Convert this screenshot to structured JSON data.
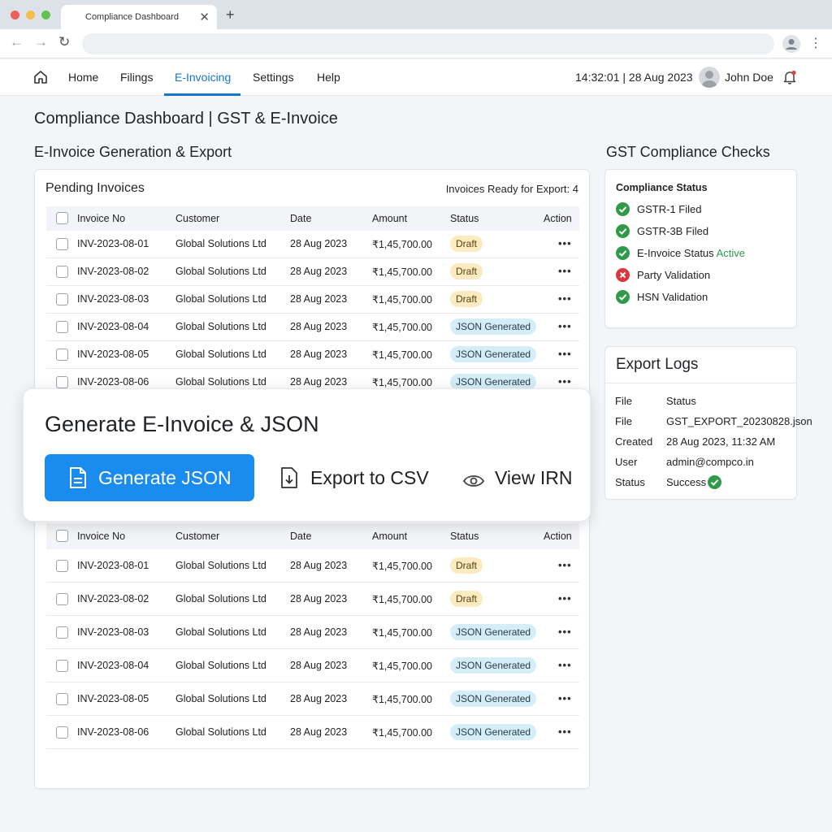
{
  "browser": {
    "tab_title": "Compliance Dashboard",
    "tab_close": "✕",
    "new_tab": "+"
  },
  "nav": {
    "items": [
      {
        "label": "Home",
        "active": false
      },
      {
        "label": "Filings",
        "active": false
      },
      {
        "label": "E-Invoicing",
        "active": true
      },
      {
        "label": "Settings",
        "active": false
      },
      {
        "label": "Help",
        "active": false
      }
    ],
    "clock": "14:32:01 | 28 Aug 2023",
    "user_name": "John Doe"
  },
  "page_title": "Compliance Dashboard | GST & E-Invoice",
  "einvoice": {
    "section_title": "E-Invoice Generation & Export",
    "card_title": "Pending Invoices",
    "ready_count": "Invoices Ready for Export: 4",
    "columns": [
      "Invoice No",
      "Customer",
      "Date",
      "Amount",
      "Status",
      "Action"
    ],
    "rows_top": [
      {
        "invoice": "INV-2023-08-01",
        "customer": "Global Solutions Ltd",
        "date": "28 Aug 2023",
        "amount": "₹1,45,700.00",
        "status": "Draft",
        "status_type": "draft"
      },
      {
        "invoice": "INV-2023-08-02",
        "customer": "Global Solutions Ltd",
        "date": "28 Aug 2023",
        "amount": "₹1,45,700.00",
        "status": "Draft",
        "status_type": "draft"
      },
      {
        "invoice": "INV-2023-08-03",
        "customer": "Global Solutions Ltd",
        "date": "28 Aug 2023",
        "amount": "₹1,45,700.00",
        "status": "Draft",
        "status_type": "draft"
      },
      {
        "invoice": "INV-2023-08-04",
        "customer": "Global Solutions Ltd",
        "date": "28 Aug 2023",
        "amount": "₹1,45,700.00",
        "status": "JSON Generated",
        "status_type": "json"
      },
      {
        "invoice": "INV-2023-08-05",
        "customer": "Global Solutions Ltd",
        "date": "28 Aug 2023",
        "amount": "₹1,45,700.00",
        "status": "JSON Generated",
        "status_type": "json"
      },
      {
        "invoice": "INV-2023-08-06",
        "customer": "Global Solutions Ltd",
        "date": "28 Aug 2023",
        "amount": "₹1,45,700.00",
        "status": "JSON Generated",
        "status_type": "json"
      }
    ],
    "rows_bottom": [
      {
        "invoice": "INV-2023-08-01",
        "customer": "Global Solutions Ltd",
        "date": "28 Aug 2023",
        "amount": "₹1,45,700.00",
        "status": "Draft",
        "status_type": "draft"
      },
      {
        "invoice": "INV-2023-08-02",
        "customer": "Global Solutions Ltd",
        "date": "28 Aug 2023",
        "amount": "₹1,45,700.00",
        "status": "Draft",
        "status_type": "draft"
      },
      {
        "invoice": "INV-2023-08-03",
        "customer": "Global Solutions Ltd",
        "date": "28 Aug 2023",
        "amount": "₹1,45,700.00",
        "status": "JSON Generated",
        "status_type": "json"
      },
      {
        "invoice": "INV-2023-08-04",
        "customer": "Global Solutions Ltd",
        "date": "28 Aug 2023",
        "amount": "₹1,45,700.00",
        "status": "JSON Generated",
        "status_type": "json"
      },
      {
        "invoice": "INV-2023-08-05",
        "customer": "Global Solutions Ltd",
        "date": "28 Aug 2023",
        "amount": "₹1,45,700.00",
        "status": "JSON Generated",
        "status_type": "json"
      },
      {
        "invoice": "INV-2023-08-06",
        "customer": "Global Solutions Ltd",
        "date": "28 Aug 2023",
        "amount": "₹1,45,700.00",
        "status": "JSON Generated",
        "status_type": "json"
      }
    ],
    "action_glyph": "•••"
  },
  "modal": {
    "title": "Generate E-Invoice & JSON",
    "generate_label": "Generate JSON",
    "export_label": "Export to CSV",
    "view_label": "View IRN"
  },
  "gst": {
    "section_title": "GST Compliance Checks",
    "card_title": "Compliance Status",
    "items": [
      {
        "label": "GSTR-1 Filed",
        "ok": true
      },
      {
        "label": "GSTR-3B Filed",
        "ok": true
      },
      {
        "label": "E-Invoice Status ",
        "suffix": "Active",
        "ok": true
      },
      {
        "label": "Party Validation",
        "ok": false
      },
      {
        "label": "HSN Validation",
        "ok": true
      }
    ]
  },
  "logs": {
    "title": "Export Logs",
    "header_key": "File",
    "header_val": "Status",
    "entries": [
      {
        "key": "File",
        "value": "GST_EXPORT_20230828.json"
      },
      {
        "key": "Created",
        "value": "28 Aug 2023, 11:32 AM"
      },
      {
        "key": "User",
        "value": "admin@compco.in"
      },
      {
        "key": "Status",
        "value": "Success"
      }
    ]
  },
  "colors": {
    "accent": "#1677c8",
    "primary_button": "#1a8cf0",
    "success": "#2e9a4a",
    "error": "#d9363e",
    "draft_badge": "#fcebc0",
    "json_badge": "#d5edf6"
  }
}
